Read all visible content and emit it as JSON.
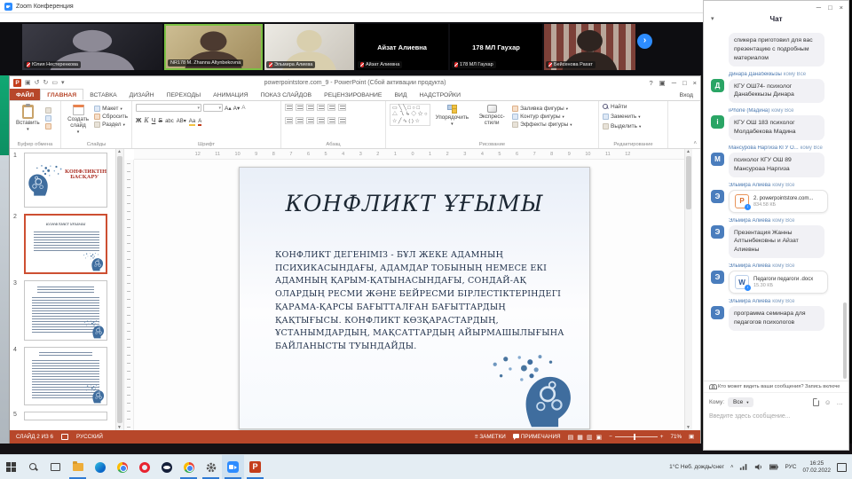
{
  "colors": {
    "ppt_accent": "#b7472a",
    "zoom_blue": "#2d8cff",
    "avatar_green": "#2aa565",
    "avatar_blue": "#4a7dbd",
    "taskbar_underline": "#2f7bd4"
  },
  "zoom_window": {
    "title": "Zoom Конференция",
    "next_arrow": "›",
    "participants": [
      "Юлия Нестеренкова",
      "NR178 М. Zhanna Altynbekovna",
      "Эльмира Алиева",
      "Айзат Алиевна",
      "178 МЛ Гаухар",
      "Бейсенова Рахат"
    ]
  },
  "ppt": {
    "window_title": "powerpointstore.com_9 - PowerPoint (Сбой активации продукта)",
    "sign_in": "Вход",
    "tabs": [
      "ФАЙЛ",
      "ГЛАВНАЯ",
      "ВСТАВКА",
      "ДИЗАЙН",
      "ПЕРЕХОДЫ",
      "АНИМАЦИЯ",
      "ПОКАЗ СЛАЙДОВ",
      "РЕЦЕНЗИРОВАНИЕ",
      "ВИД",
      "НАДСТРОЙКИ"
    ],
    "ribbon": {
      "paste": "Вставить",
      "new_slide": "Создать слайд",
      "layout": "Макет",
      "reset": "Сбросить",
      "section": "Раздел",
      "arrange": "Упорядочить",
      "quick_styles": "Экспресс-стили",
      "shape_fill": "Заливка фигуры",
      "shape_outline": "Контур фигуры",
      "shape_effects": "Эффекты фигуры",
      "find": "Найти",
      "replace": "Заменить",
      "select": "Выделить",
      "groups": [
        "Буфер обмена",
        "Слайды",
        "Шрифт",
        "Абзац",
        "Рисование",
        "Редактирование"
      ]
    },
    "ruler_numbers": "12 11 10 9 8 7 6 5 4 3 2 1 0 1 2 3 4 5 6 7 8 9 10 11 12",
    "slide": {
      "title": "КОНФЛИКТ ҰҒЫМЫ",
      "body": "КОНФЛИКТ ДЕГЕНІМІЗ - БҰЛ ЖЕКЕ АДАМНЫҢ ПСИХИКАСЫНДАҒЫ, АДАМДАР ТОБЫНЫҢ НЕМЕСЕ ЕКІ АДАМНЫҢ ҚАРЫМ-ҚАТЫНАСЫНДАҒЫ, СОНДАЙ-АҚ ОЛАРДЫҢ РЕСМИ ЖӘНЕ БЕЙРЕСМИ БІРЛЕСТІКТЕРІНДЕГІ ҚАРАМА-ҚАРСЫ БАҒЫТТАЛҒАН БАҒЫТТАРДЫҢ ҚАҚТЫҒЫСЫ. КОНФЛИКТ КӨЗҚАРАСТАРДЫҢ, ҰСТАНЫМДАРДЫҢ, МАҚСАТТАРДЫҢ АЙЫРМАШЫЛЫҒЫНА БАЙЛАНЫСТЫ ТУЫНДАЙДЫ."
    },
    "slide1_title": "КОНФЛИКТІНІ БАСҚАРУ",
    "thumb_numbers": [
      "1",
      "2",
      "3",
      "4",
      "5"
    ],
    "status": {
      "slide_counter": "СЛАЙД 2 ИЗ 6",
      "language": "РУССКИЙ",
      "notes": "ЗАМЕТКИ",
      "comments": "ПРИМЕЧАНИЯ",
      "zoom_level": "71%"
    }
  },
  "chat": {
    "title": "Чат",
    "messages": [
      {
        "type": "text",
        "sender": "",
        "to": "",
        "avatar": "",
        "text": "спикера приготовил для вас презентацию с подробным материалом"
      },
      {
        "type": "text",
        "sender": "Динара Данабеккызы",
        "to": "кому Все",
        "avatar": "Д",
        "text": "КГУ ОШ74- психолог Данабеккызы Динара"
      },
      {
        "type": "text",
        "sender": "iPhone (Мадина)",
        "to": "кому Все",
        "avatar": "i",
        "text": "КГУ ОШ 183 психолог Молдабекова Мадина"
      },
      {
        "type": "text",
        "sender": "Мансурова Наргиза КГУ О...",
        "to": "кому Все",
        "avatar": "М",
        "text": "психолог КГУ ОШ 89 Мансуроаа Наргиза"
      },
      {
        "type": "file",
        "sender": "Эльмира Алиева",
        "to": "кому Все",
        "avatar": "Э",
        "filename": "2. powerpointstore.com...",
        "filesize": "834.58 КБ"
      },
      {
        "type": "text",
        "sender": "Эльмира Алиева",
        "to": "кому Все",
        "avatar": "Э",
        "text": "Презентация Жанны Алтынбековны и Айзат Алиевны"
      },
      {
        "type": "file",
        "sender": "Эльмира Алиева",
        "to": "кому Все",
        "avatar": "Э",
        "filename": "Педагоги педагоги .docx",
        "filesize": "15.30 КБ"
      },
      {
        "type": "text",
        "sender": "Эльмира Алиева",
        "to": "кому Все",
        "avatar": "Э",
        "text": "программа семинара для педагогов психологов"
      }
    ],
    "privacy": "Кто может видеть ваши сообщения? Запись включе",
    "to_label": "Кому:",
    "to_value": "Все",
    "placeholder": "Введите здесь сообщение..."
  },
  "taskbar": {
    "weather": "1°C Неб. дождь/снег",
    "lang": "РУС",
    "time": "16:25",
    "date": "07.02.2022"
  }
}
